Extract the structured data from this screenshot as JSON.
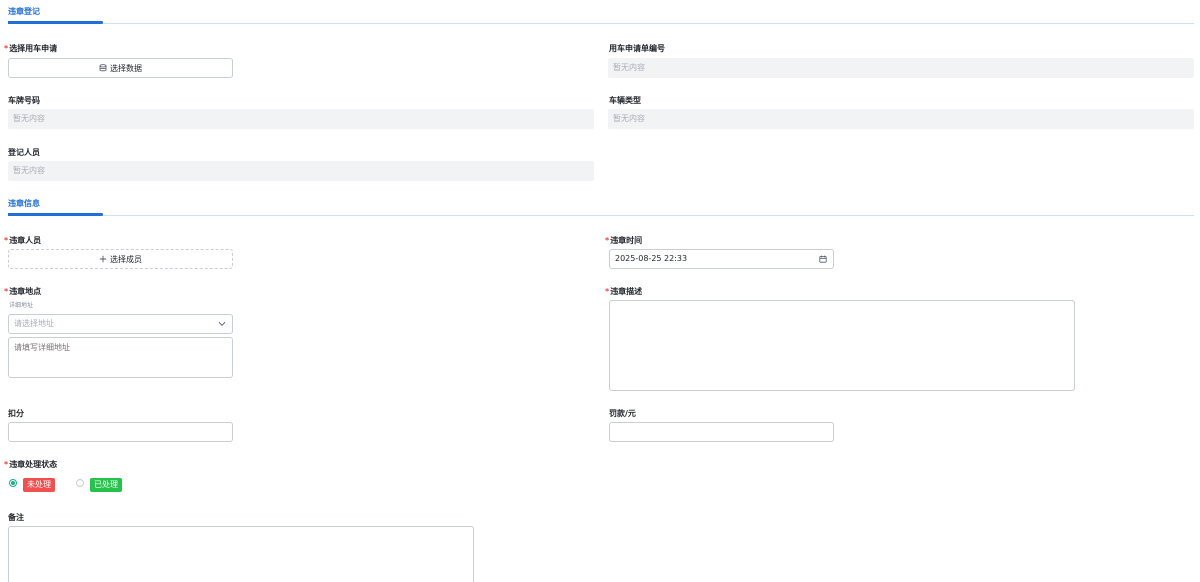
{
  "sections": {
    "violation_register": {
      "title": "违章登记"
    },
    "violation_info": {
      "title": "违章信息"
    }
  },
  "fields": {
    "vehicle_request": {
      "label": "选择用车申请",
      "required": true,
      "button_label": "选择数据",
      "button_icon": "database-icon"
    },
    "request_number": {
      "label": "用车申请单编号",
      "value": "暂无内容"
    },
    "plate_number": {
      "label": "车牌号码",
      "value": "暂无内容"
    },
    "vehicle_type": {
      "label": "车辆类型",
      "value": "暂无内容"
    },
    "registrant": {
      "label": "登记人员",
      "value": "暂无内容"
    },
    "violator": {
      "label": "违章人员",
      "required": true,
      "button_label": "选择成员",
      "button_icon": "plus-icon"
    },
    "violation_time": {
      "label": "违章时间",
      "required": true,
      "value": "2025-08-25 22:33",
      "icon": "calendar-icon"
    },
    "violation_location": {
      "label": "违章地点",
      "required": true,
      "sublabel": "详细地址",
      "select_placeholder": "请选择地址",
      "textarea_placeholder": "请填写详细地址"
    },
    "violation_description": {
      "label": "违章描述",
      "required": true,
      "value": ""
    },
    "points": {
      "label": "扣分",
      "value": ""
    },
    "fine": {
      "label": "罚款/元",
      "value": ""
    },
    "status": {
      "label": "违章处理状态",
      "required": true,
      "options": [
        {
          "label": "未处理",
          "checked": true,
          "color": "#f05050"
        },
        {
          "label": "已处理",
          "checked": false,
          "color": "#27c24c"
        }
      ]
    },
    "remarks": {
      "label": "备注",
      "value": ""
    }
  },
  "colors": {
    "accent": "#1e6fd9",
    "required": "#f53f3f",
    "radio_checked": "#1aae88"
  }
}
